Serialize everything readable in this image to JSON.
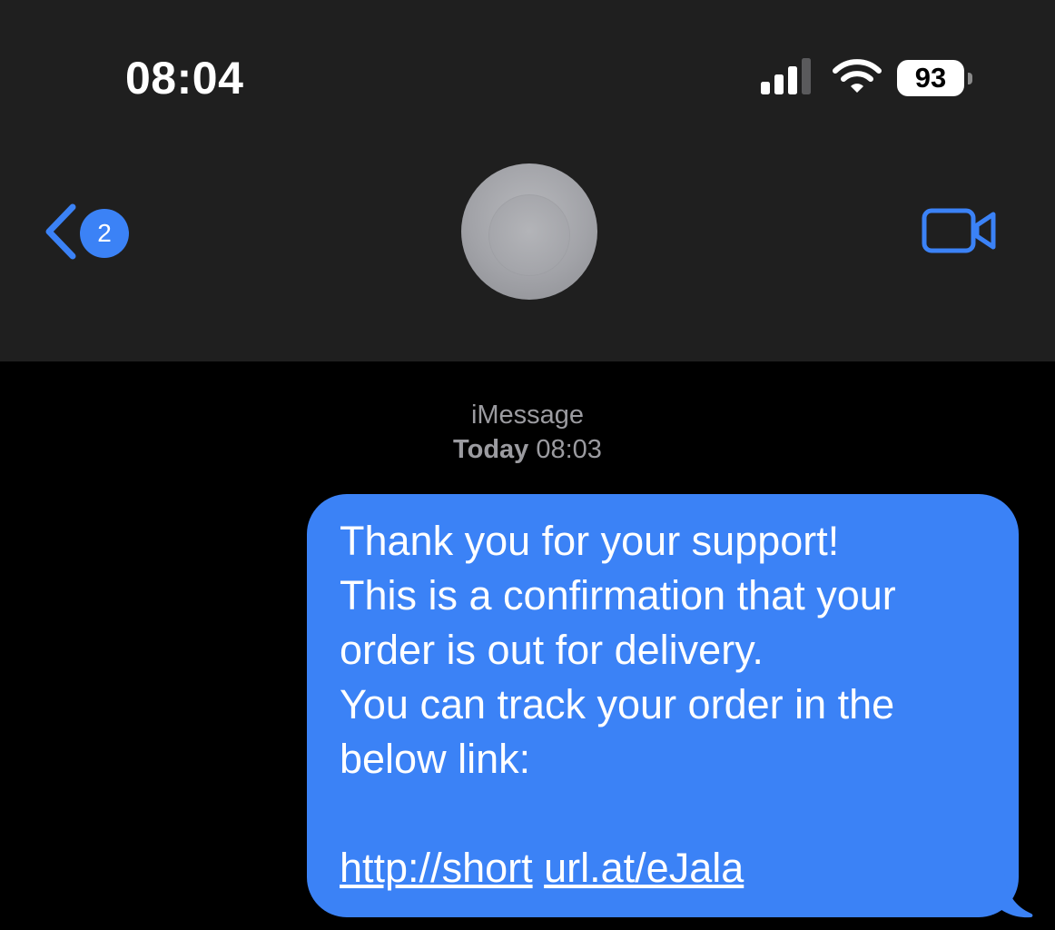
{
  "status_bar": {
    "time": "08:04",
    "battery_level": "93",
    "signal_bars_filled": 3,
    "signal_bars_total": 4
  },
  "nav": {
    "back_badge_count": "2",
    "back_icon": "chevron-left-icon",
    "video_icon": "video-camera-icon",
    "accent_color": "#3b82f6"
  },
  "conversation": {
    "service_label": "iMessage",
    "date_day": "Today",
    "date_time": "08:03"
  },
  "message": {
    "lines": [
      "Thank you for your support!",
      "This is a confirmation that your",
      "order is out for delivery.",
      "You can track your order in the",
      "below link:"
    ],
    "text": "Thank you for your support!\nThis is a confirmation that your\norder is out for delivery.\nYou can track your order in the\nbelow link:",
    "link_part1": "http://short",
    "link_part2": "url.at/eJala",
    "bubble_color": "#3b82f6"
  }
}
